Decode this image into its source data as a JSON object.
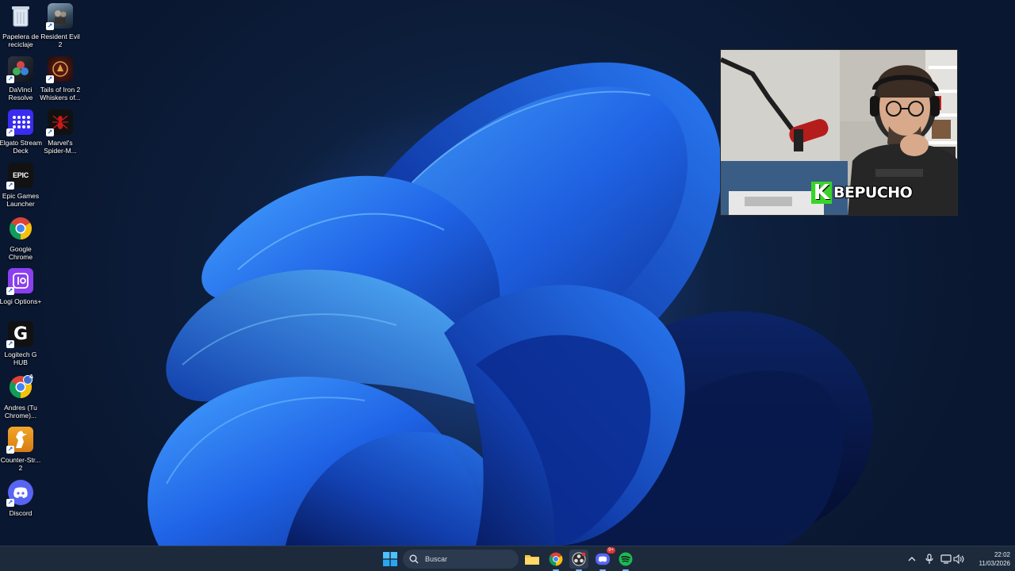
{
  "desktop": {
    "icons": [
      {
        "label": "Papelera de reciclaje",
        "icon": "recycle-bin-icon"
      },
      {
        "label": "Resident Evil 2",
        "icon": "resident-evil-icon"
      },
      {
        "label": "DaVinci Resolve",
        "icon": "davinci-icon"
      },
      {
        "label": "Tails of Iron 2 Whiskers of...",
        "icon": "tails-of-iron-icon"
      },
      {
        "label": "Elgato Stream Deck",
        "icon": "stream-deck-icon"
      },
      {
        "label": "Marvel's Spider-M...",
        "icon": "spiderman-icon"
      },
      {
        "label": "Epic Games Launcher",
        "icon": "epic-games-icon",
        "glyph": "EPIC"
      },
      {
        "label": "Google Chrome",
        "icon": "chrome-icon"
      },
      {
        "label": "Logi Options+",
        "icon": "logi-options-icon"
      },
      {
        "label": "Logitech G HUB",
        "icon": "logitech-g-icon",
        "glyph": "G"
      },
      {
        "label": "Andres (Tu Chrome)...",
        "icon": "chrome-profile-icon",
        "glyph": "A"
      },
      {
        "label": "Counter-Str... 2",
        "icon": "counter-strike-icon"
      },
      {
        "label": "Discord",
        "icon": "discord-icon"
      }
    ]
  },
  "webcam": {
    "badge_letter": "K",
    "name": "BEPUCHO"
  },
  "taskbar": {
    "search_label": "Buscar",
    "apps": [
      {
        "icon": "windows-start-icon"
      },
      {
        "icon": "file-explorer-icon"
      },
      {
        "icon": "chrome-icon"
      },
      {
        "icon": "obs-icon"
      },
      {
        "icon": "discord-icon",
        "badge": "9+"
      },
      {
        "icon": "spotify-icon"
      }
    ],
    "tray": [
      "chevron-up-icon",
      "microphone-icon",
      "network-icon",
      "volume-icon"
    ],
    "clock_time": "22:02",
    "clock_date": "11/03/2026"
  },
  "colors": {
    "taskbar": "#1c2a3c",
    "accent_blue": "#1f63e6",
    "discord": "#5865f2",
    "spotify": "#1db954",
    "webcam_badge": "#39d42a"
  }
}
